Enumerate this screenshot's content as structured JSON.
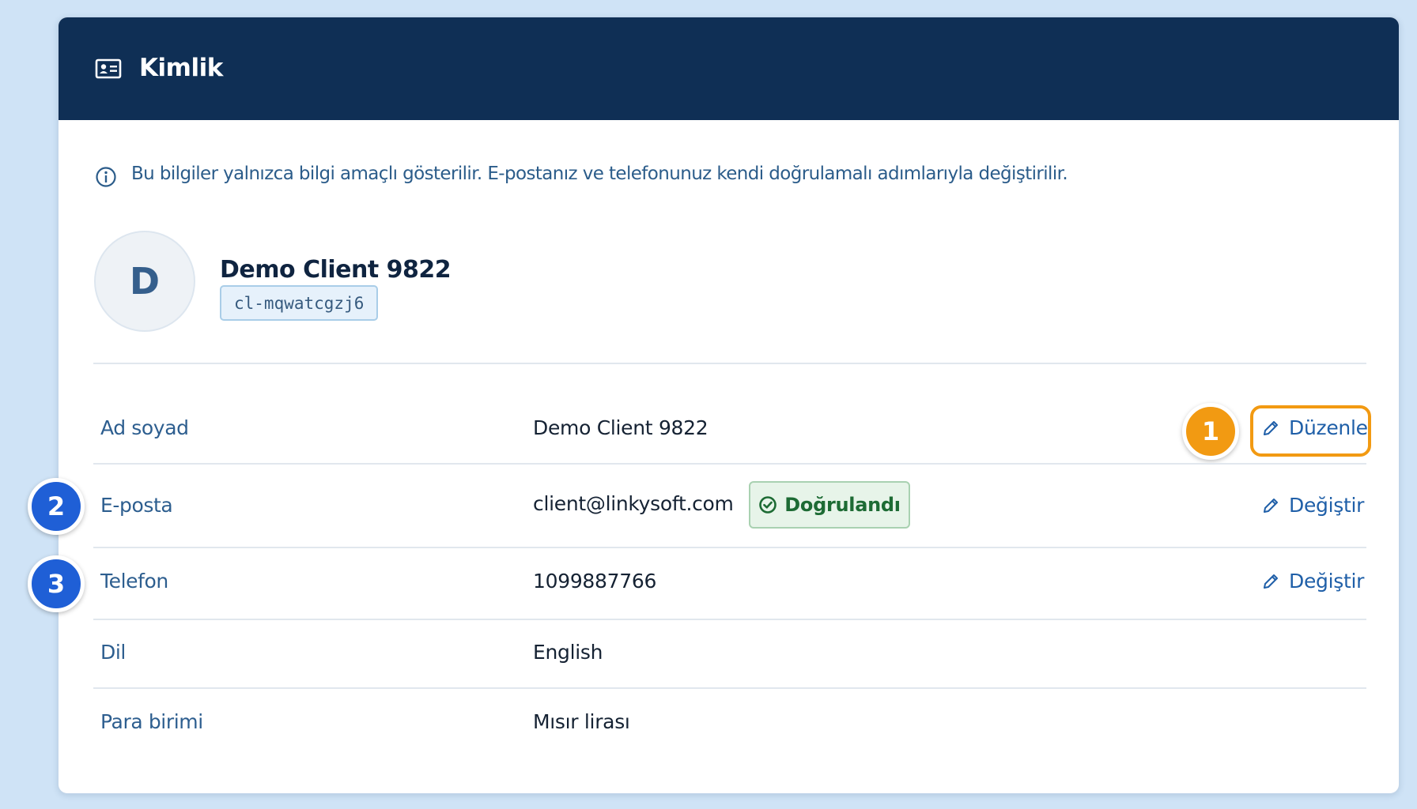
{
  "header": {
    "title": "Kimlik",
    "icon": "id-card-icon"
  },
  "notice": {
    "icon": "info-icon",
    "text": "Bu bilgiler yalnızca bilgi amaçlı gösterilir. E-postanız ve telefonunuz kendi doğrulamalı adımlarıyla değiştirilir."
  },
  "profile": {
    "avatar_letter": "D",
    "name": "Demo Client 9822",
    "client_id": "cl-mqwatcgzj6"
  },
  "fields": {
    "full_name": {
      "label": "Ad soyad",
      "value": "Demo Client 9822",
      "action": "Düzenle"
    },
    "email": {
      "label": "E-posta",
      "value": "client@linkysoft.com",
      "badge": "Doğrulandı",
      "action": "Değiştir"
    },
    "phone": {
      "label": "Telefon",
      "value": "1099887766",
      "action": "Değiştir"
    },
    "language": {
      "label": "Dil",
      "value": "English"
    },
    "currency": {
      "label": "Para birimi",
      "value": "Mısır lirası"
    }
  },
  "markers": [
    "1",
    "2",
    "3"
  ],
  "colors": {
    "header_bg": "#0f2f55",
    "accent_orange": "#f29a12",
    "marker_blue": "#1f5fd6",
    "link_blue": "#1f5fa8",
    "verified_green": "#1d6b34"
  }
}
